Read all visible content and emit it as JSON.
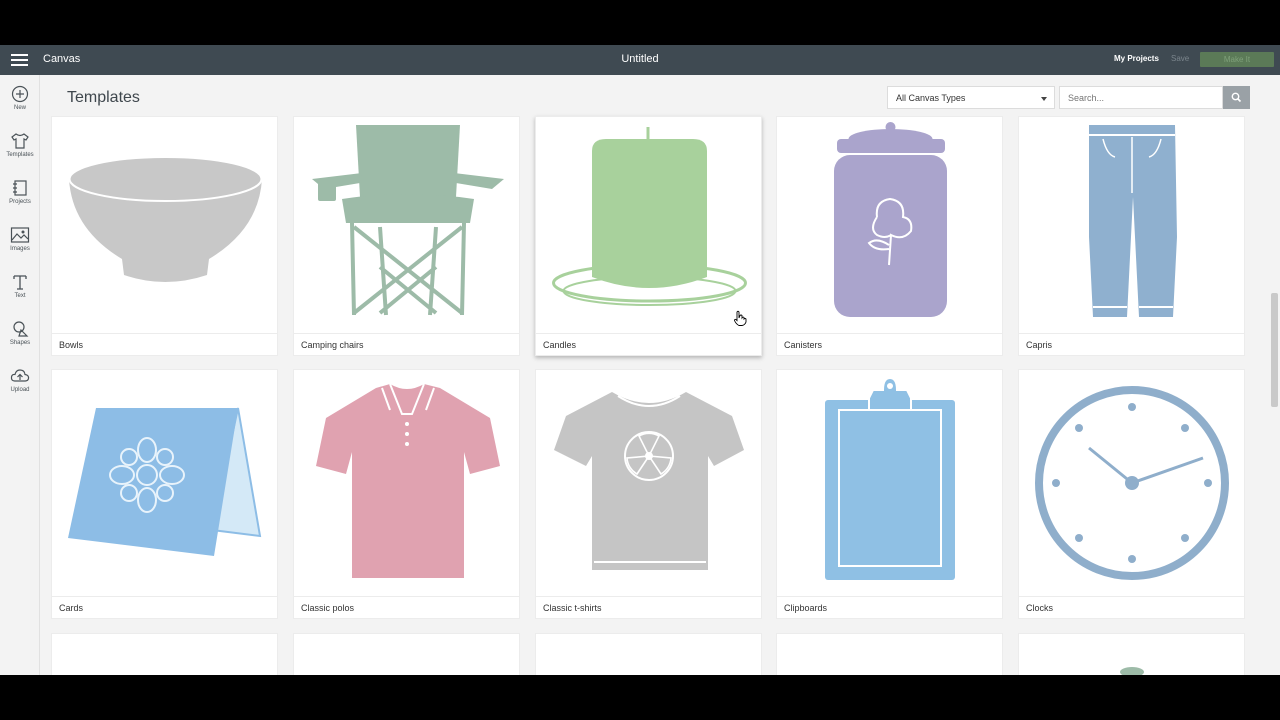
{
  "topbar": {
    "app_title": "Canvas",
    "doc_title": "Untitled",
    "my_projects": "My Projects",
    "save": "Save",
    "make_it": "Make It"
  },
  "sidebar": {
    "items": [
      {
        "label": "New",
        "icon": "plus-circle-icon"
      },
      {
        "label": "Templates",
        "icon": "tshirt-icon"
      },
      {
        "label": "Projects",
        "icon": "notebook-icon"
      },
      {
        "label": "Images",
        "icon": "image-icon"
      },
      {
        "label": "Text",
        "icon": "text-t-icon"
      },
      {
        "label": "Shapes",
        "icon": "shapes-icon"
      },
      {
        "label": "Upload",
        "icon": "cloud-upload-icon"
      }
    ]
  },
  "main": {
    "title": "Templates",
    "canvas_type_select": "All Canvas Types",
    "search_placeholder": "Search..."
  },
  "templates": [
    {
      "label": "Bowls",
      "icon": "bowl-icon",
      "color": "#c8c8c8"
    },
    {
      "label": "Camping chairs",
      "icon": "camping-chair-icon",
      "color": "#9dbba8"
    },
    {
      "label": "Candles",
      "icon": "candle-icon",
      "color": "#a8d19c"
    },
    {
      "label": "Canisters",
      "icon": "canister-icon",
      "color": "#aaa4cc"
    },
    {
      "label": "Capris",
      "icon": "capris-icon",
      "color": "#8fb0cf"
    },
    {
      "label": "Cards",
      "icon": "card-icon",
      "color": "#8dbde6"
    },
    {
      "label": "Classic polos",
      "icon": "polo-icon",
      "color": "#e0a2b0"
    },
    {
      "label": "Classic t-shirts",
      "icon": "tshirt-icon",
      "color": "#c5c5c5"
    },
    {
      "label": "Clipboards",
      "icon": "clipboard-icon",
      "color": "#8fc0e4"
    },
    {
      "label": "Clocks",
      "icon": "clock-icon",
      "color": "#8faecb"
    }
  ]
}
